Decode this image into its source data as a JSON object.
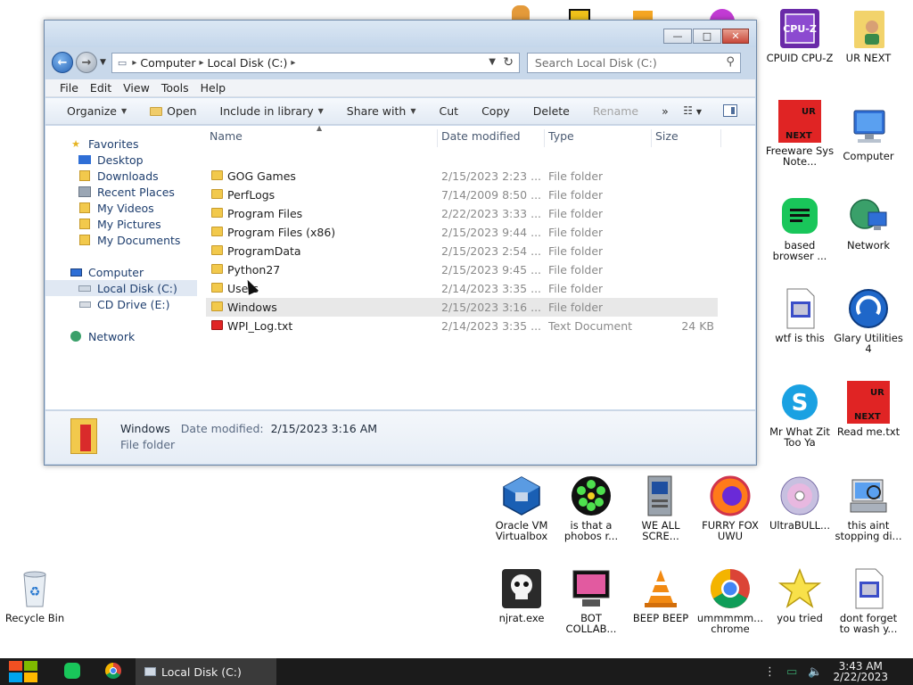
{
  "window": {
    "address": {
      "crumbs": [
        "Computer",
        "Local Disk (C:)"
      ]
    },
    "search_placeholder": "Search Local Disk (C:)",
    "caption": {
      "minimize": "—",
      "maximize": "□",
      "close": "✕"
    },
    "menu": [
      "File",
      "Edit",
      "View",
      "Tools",
      "Help"
    ],
    "commands": {
      "organize": "Organize",
      "open": "Open",
      "include": "Include in library",
      "share": "Share with",
      "cut": "Cut",
      "copy": "Copy",
      "delete": "Delete",
      "rename": "Rename",
      "more": "»"
    },
    "nav": {
      "favorites": "Favorites",
      "desktop": "Desktop",
      "downloads": "Downloads",
      "recent": "Recent Places",
      "videos": "My Videos",
      "pictures": "My Pictures",
      "documents": "My Documents",
      "computer": "Computer",
      "local_disk": "Local Disk (C:)",
      "cd_drive": "CD Drive (E:)",
      "network": "Network"
    },
    "columns": {
      "name": "Name",
      "date": "Date modified",
      "type": "Type",
      "size": "Size"
    },
    "files": [
      {
        "name": "GOG Games",
        "date": "2/15/2023 2:23 ...",
        "type": "File folder",
        "size": ""
      },
      {
        "name": "PerfLogs",
        "date": "7/14/2009 8:50 ...",
        "type": "File folder",
        "size": ""
      },
      {
        "name": "Program Files",
        "date": "2/22/2023 3:33 ...",
        "type": "File folder",
        "size": ""
      },
      {
        "name": "Program Files (x86)",
        "date": "2/15/2023 9:44 ...",
        "type": "File folder",
        "size": ""
      },
      {
        "name": "ProgramData",
        "date": "2/15/2023 2:54 ...",
        "type": "File folder",
        "size": ""
      },
      {
        "name": "Python27",
        "date": "2/15/2023 9:45 ...",
        "type": "File folder",
        "size": ""
      },
      {
        "name": "Users",
        "date": "2/14/2023 3:35 ...",
        "type": "File folder",
        "size": ""
      },
      {
        "name": "Windows",
        "date": "2/15/2023 3:16 ...",
        "type": "File folder",
        "size": ""
      },
      {
        "name": "WPI_Log.txt",
        "date": "2/14/2023 3:35 ...",
        "type": "Text Document",
        "size": "24 KB"
      }
    ],
    "details": {
      "name": "Windows",
      "date_label": "Date modified:",
      "date_value": "2/15/2023 3:16 AM",
      "type": "File folder"
    }
  },
  "desktop_icons": {
    "cpuz": "CPUID CPU-Z",
    "urnext": "UR NEXT",
    "freeware": "Freeware Sys Note...",
    "computer": "Computer",
    "based": "based browser ...",
    "network": "Network",
    "wtf": "wtf is this",
    "glary": "Glary Utilities 4",
    "skype": "Mr What Zit Too Ya",
    "readme": "Read me.txt",
    "oracle": "Oracle VM Virtualbox",
    "phobos": "is that a phobos r...",
    "weall": "WE ALL SCRE...",
    "furry": "FURRY FOX UWU",
    "ultrabull": "UltraBULL...",
    "stopping": "this aint stopping di...",
    "recycle": "Recycle Bin",
    "njrat": "njrat.exe",
    "botcollab": "BOT COLLAB...",
    "beep": "BEEP BEEP",
    "chrome": "ummmmm... chrome",
    "youtried": "you tried",
    "dontforget": "dont forget to wash y..."
  },
  "taskbar": {
    "task_label": "Local Disk (C:)",
    "time": "3:43 AM",
    "date": "2/22/2023"
  },
  "colors": {
    "accent": "#2663b5",
    "taskbar": "#1b1b1b",
    "folder": "#f2c94c",
    "ur_next_red": "#e02424"
  }
}
